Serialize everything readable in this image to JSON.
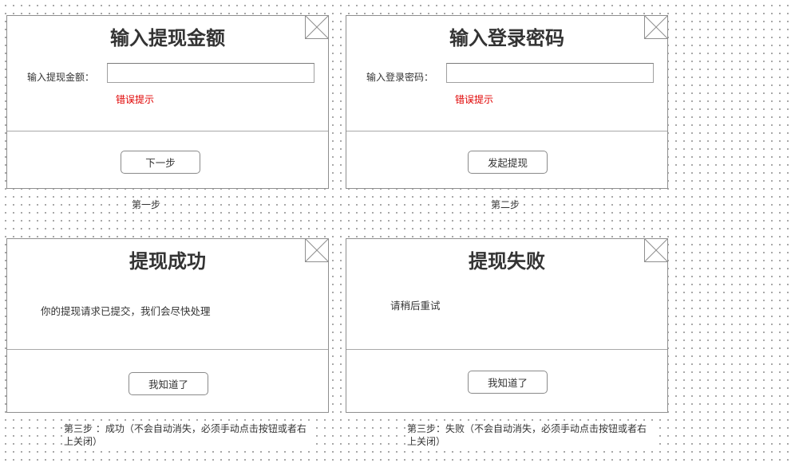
{
  "step1": {
    "title": "输入提现金额",
    "field_label": "输入提现金额：",
    "input_value": "",
    "error": "错误提示",
    "button": "下一步",
    "caption": "第一步"
  },
  "step2": {
    "title": "输入登录密码",
    "field_label": "输入登录密码：",
    "input_value": "",
    "error": "错误提示",
    "button": "发起提现",
    "caption": "第二步"
  },
  "step3": {
    "title": "提现成功",
    "message": "你的提现请求已提交，我们会尽快处理",
    "button": "我知道了",
    "caption": "第三步 ：成功（不会自动消失，必须手动点击按钮或者右上关闭）"
  },
  "step4": {
    "title": "提现失败",
    "message": "请稍后重试",
    "button": "我知道了",
    "caption": "第三步：失败（不会自动消失，必须手动点击按钮或者右上关闭）"
  },
  "icons": {
    "close": "close-icon"
  },
  "colors": {
    "error": "#e00000",
    "border": "#8f8f8f",
    "text": "#333333"
  }
}
